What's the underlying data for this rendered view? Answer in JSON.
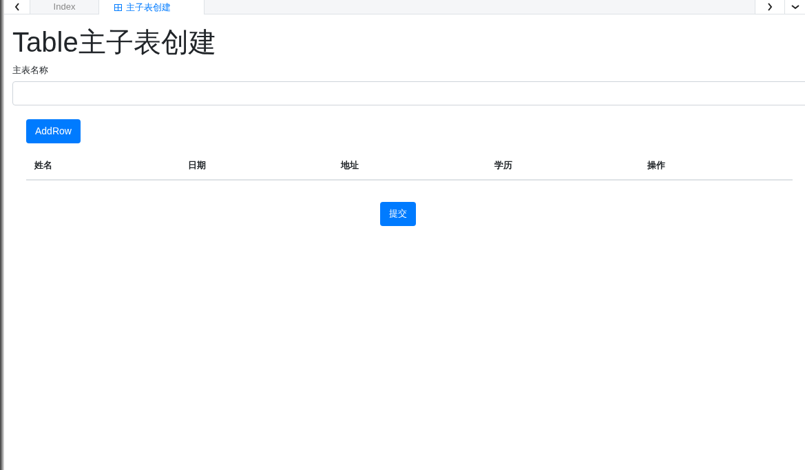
{
  "tabs": [
    {
      "label": "Index",
      "selected": false
    },
    {
      "label": "主子表创建",
      "selected": true
    }
  ],
  "heading": "Table主子表创建",
  "master_name": {
    "label": "主表名称"
  },
  "add_button": "AddRow",
  "table": {
    "columns": [
      "姓名",
      "日期",
      "地址",
      "学历",
      "操作"
    ]
  },
  "submit_button": "提交"
}
